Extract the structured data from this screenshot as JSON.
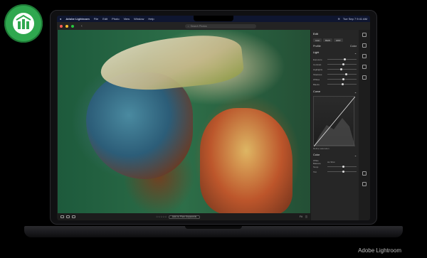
{
  "badge": {
    "icon": "store-logo-icon",
    "color": "#2fa84f"
  },
  "menubar": {
    "app_name": "Adobe Lightroom",
    "items": [
      "File",
      "Edit",
      "Photo",
      "View",
      "Window",
      "Help"
    ],
    "clock": "Tue Sep 7  9:41 AM"
  },
  "toolbar": {
    "search_placeholder": "Search Photos"
  },
  "panel": {
    "title": "Edit",
    "tabs": [
      "Auto",
      "B&W",
      "HDR"
    ],
    "profile_label": "Profile",
    "profile_value": "Color",
    "light": {
      "heading": "Light",
      "sliders": [
        {
          "label": "Exposure",
          "value": 0.55
        },
        {
          "label": "Contrast",
          "value": 0.5
        },
        {
          "label": "Highlights",
          "value": 0.45
        },
        {
          "label": "Shadows",
          "value": 0.6
        },
        {
          "label": "Whites",
          "value": 0.5
        },
        {
          "label": "Blacks",
          "value": 0.48
        }
      ]
    },
    "curve": {
      "heading": "Curve",
      "footer": "Refine saturation"
    },
    "color": {
      "heading": "Color",
      "wb_label": "White Balance",
      "wb_value": "As Shot",
      "temp_label": "Temp",
      "tint_label": "Tint"
    }
  },
  "photo_bar": {
    "zoom_label": "Fit",
    "sort_label": "Add to Plan Keywords"
  },
  "caption": "Adobe Lightroom"
}
